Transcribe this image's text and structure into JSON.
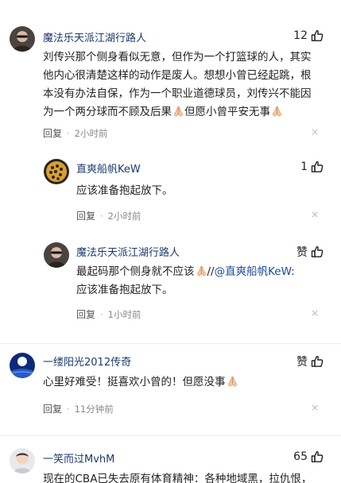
{
  "comments": [
    {
      "username": "魔法乐天派江湖行路人",
      "likes": "12",
      "lines": [
        "刘传兴那个侧身看似无意，但作为一个打篮球的人，其实",
        "他内心很清楚这样的动作是废人。想想小曾已经起跳，根",
        "本没有办法自保，作为一个职业道德球员，刘传兴不能因",
        "为一个两分球而不顾及后果",
        "但愿小曾平安无事"
      ],
      "reply_label": "回复",
      "time": "2小时前",
      "close": "×"
    },
    {
      "username": "直爽船帆KeW",
      "likes": "1",
      "lines": [
        "应该准备抱起放下。"
      ],
      "reply_label": "回复",
      "time": "2小时前",
      "close": "×"
    },
    {
      "username": "魔法乐天派江湖行路人",
      "likes": "赞",
      "line1_text": "最起码那个侧身就不应该",
      "line1_sep": "//",
      "mention": "@直爽船帆KeW",
      "line1_colon": ":",
      "line2": "应该准备抱起放下。",
      "reply_label": "回复",
      "time": "1小时前",
      "close": "×"
    },
    {
      "username": "一缕阳光2012传奇",
      "likes": "赞",
      "lines": [
        "心里好难受！挺喜欢小曾的！但愿没事"
      ],
      "reply_label": "回复",
      "time": "11分钟前",
      "close": "×"
    },
    {
      "username": "一笑而过MvhM",
      "likes": "65",
      "lines": [
        "现在的CBA已失去原有体育精神：各种地域黑，拉仇恨，"
      ]
    }
  ],
  "colors": {
    "username": "#1a3a6e",
    "mention": "#1a4a9e",
    "meta": "#888888"
  },
  "icons": {
    "like": "thumbs-up-icon",
    "pray": "praying-hands-emoji",
    "close": "close-icon"
  }
}
